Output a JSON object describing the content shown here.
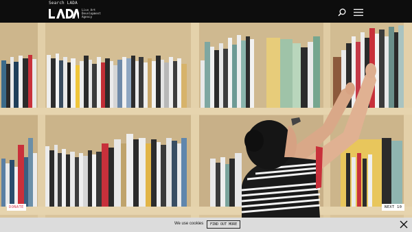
{
  "header": {
    "search_label": "Search LADA",
    "logo_text": "LADA",
    "logo_subtitle": [
      "Live Art",
      "Development",
      "Agency"
    ],
    "search_icon": "search-icon",
    "menu_icon": "hamburger-menu-icon"
  },
  "hero": {
    "image": "person-reaching-for-book-on-library-shelf"
  },
  "actions": {
    "donate_label": "DONATE",
    "next_label": "NEXT 10"
  },
  "cookie_bar": {
    "text": "We use cookies",
    "button_label": "FIND OUT MORE",
    "close_icon": "close-icon"
  },
  "colors": {
    "header_bg": "#0d0d0d",
    "donate_accent": "#d8344c",
    "cookie_bg": "#dcdcdc",
    "shelf_wood": "#d7c39b"
  }
}
